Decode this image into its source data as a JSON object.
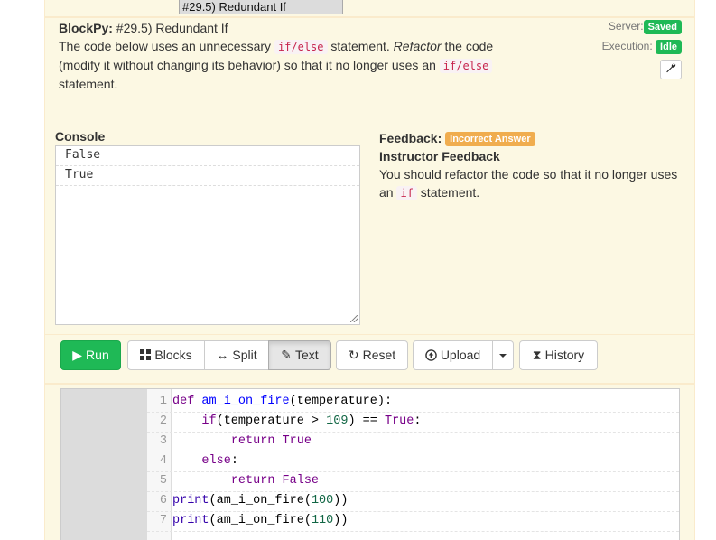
{
  "assignment_selector": {
    "value": "#29.5) Redundant If"
  },
  "header": {
    "app_label": "BlockPy:",
    "title": " #29.5) Redundant If",
    "description": [
      {
        "t": "text",
        "v": "The code below uses an unnecessary "
      },
      {
        "t": "code",
        "v": "if/else"
      },
      {
        "t": "text",
        "v": " statement. "
      },
      {
        "t": "em",
        "v": "Refactor"
      },
      {
        "t": "text",
        "v": " the code (modify it without changing its behavior) so that it no longer uses an "
      },
      {
        "t": "code",
        "v": "if/else"
      },
      {
        "t": "text",
        "v": " statement."
      }
    ]
  },
  "status": {
    "server_label": "Server:",
    "server_value": "Saved",
    "execution_label": "Execution:",
    "execution_value": "Idle",
    "settings_icon": "wrench-icon",
    "colors": {
      "ok": "#1fb956",
      "warn": "#f0ad4e"
    }
  },
  "console": {
    "label": "Console",
    "lines": [
      "False",
      "True"
    ]
  },
  "feedback": {
    "label": "Feedback:",
    "badge": "Incorrect Answer",
    "title": "Instructor Feedback",
    "message_before": "You should refactor the code so that it no longer uses an ",
    "message_code": "if",
    "message_after": " statement."
  },
  "toolbar": {
    "run": "Run",
    "blocks": "Blocks",
    "split": "Split",
    "text": "Text",
    "reset": "Reset",
    "upload": "Upload",
    "history": "History",
    "active_mode": "Text"
  },
  "editor": {
    "lines": [
      [
        [
          "kw",
          "def"
        ],
        [
          "",
          " "
        ],
        [
          "def",
          "am_i_on_fire"
        ],
        [
          "",
          "(temperature):"
        ]
      ],
      [
        [
          "",
          "    "
        ],
        [
          "kw",
          "if"
        ],
        [
          "",
          "",
          " "
        ],
        [
          "",
          "(temperature > "
        ],
        [
          "num",
          "109"
        ],
        [
          "",
          ") == "
        ],
        [
          "kw",
          "True"
        ],
        [
          "",
          ":"
        ]
      ],
      [
        [
          "",
          "        "
        ],
        [
          "kw",
          "return"
        ],
        [
          "",
          " "
        ],
        [
          "kw",
          "True"
        ]
      ],
      [
        [
          "",
          "    "
        ],
        [
          "kw",
          "else"
        ],
        [
          "",
          ":"
        ]
      ],
      [
        [
          "",
          "        "
        ],
        [
          "kw",
          "return"
        ],
        [
          "",
          " "
        ],
        [
          "kw",
          "False"
        ]
      ],
      [
        [
          "bi",
          "print"
        ],
        [
          "",
          "(am_i_on_fire("
        ],
        [
          "num",
          "100"
        ],
        [
          "",
          "))"
        ]
      ],
      [
        [
          "bi",
          "print"
        ],
        [
          "",
          "(am_i_on_fire("
        ],
        [
          "num",
          "110"
        ],
        [
          "",
          "))"
        ]
      ]
    ]
  }
}
